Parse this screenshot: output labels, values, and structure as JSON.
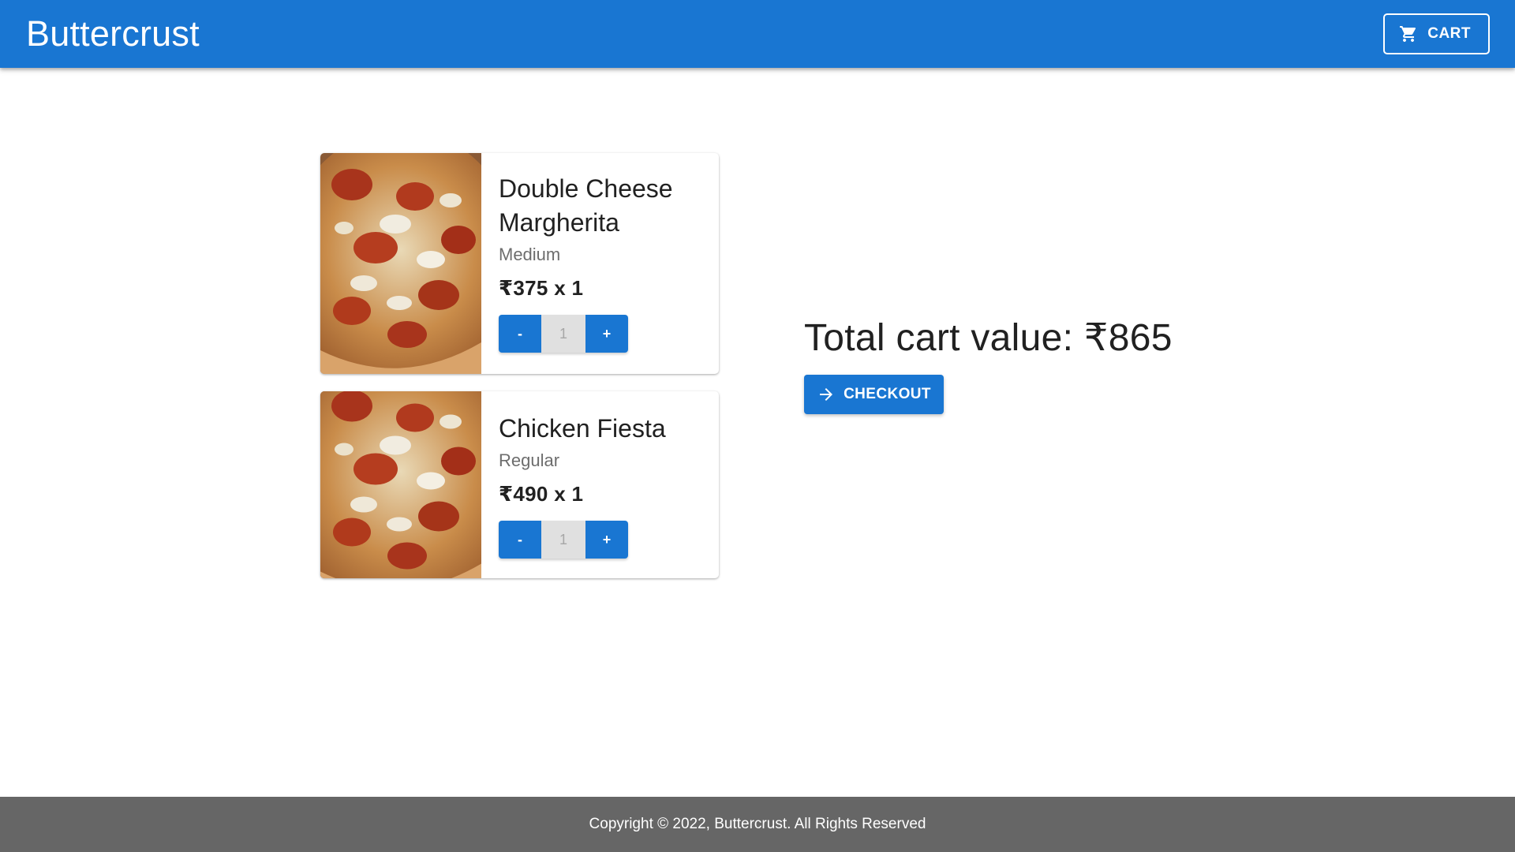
{
  "header": {
    "brand": "Buttercrust",
    "cart_label": "CART"
  },
  "cart": {
    "items": [
      {
        "name": "Double Cheese Margherita",
        "size": "Medium",
        "price_line": "₹375 x 1",
        "decrement_label": "-",
        "quantity": "1",
        "increment_label": "+"
      },
      {
        "name": "Chicken Fiesta",
        "size": "Regular",
        "price_line": "₹490 x 1",
        "decrement_label": "-",
        "quantity": "1",
        "increment_label": "+"
      }
    ],
    "total_text": "Total cart value: ₹865",
    "checkout_label": "CHECKOUT"
  },
  "footer": {
    "copyright": "Copyright © 2022, Buttercrust. All Rights Reserved"
  },
  "colors": {
    "primary": "#1976d2",
    "footer_bg": "#666666",
    "qty_bg": "#e0e0e0"
  },
  "icons": {
    "cart": "shopping-cart-icon",
    "checkout": "arrow-right-icon"
  }
}
